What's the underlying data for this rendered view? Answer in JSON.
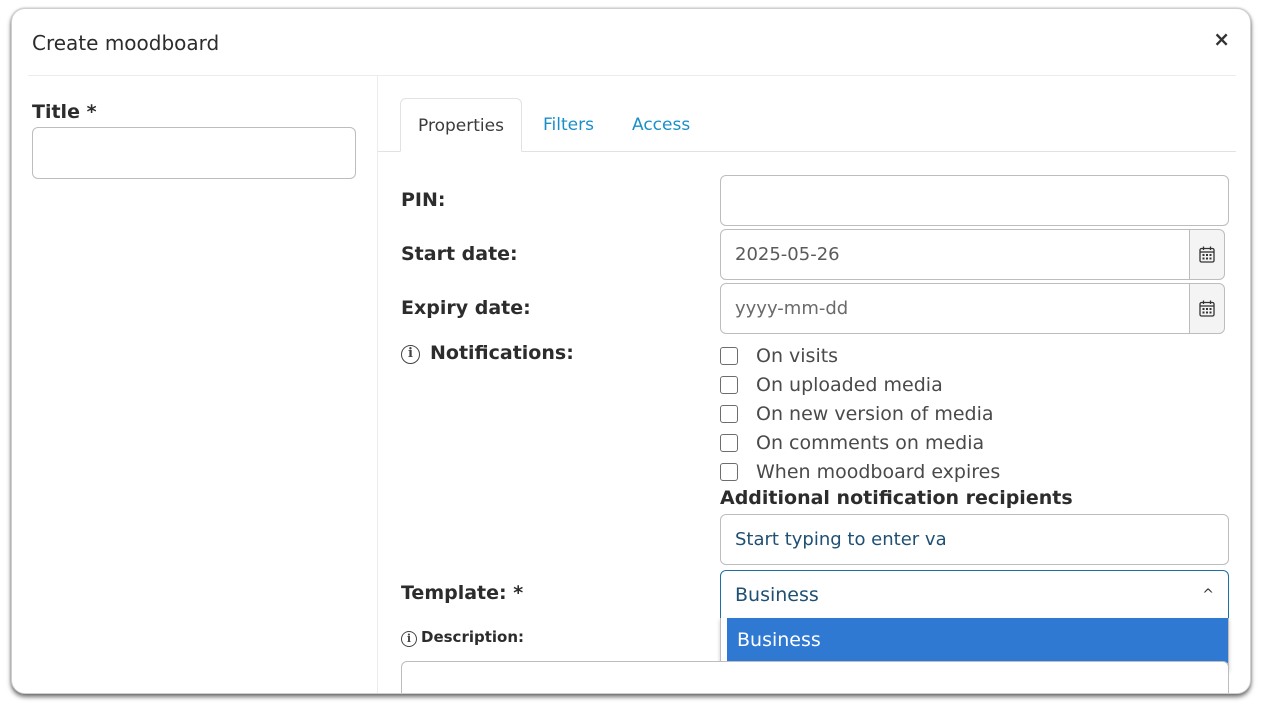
{
  "dialog": {
    "title": "Create moodboard",
    "close_icon": "×"
  },
  "left": {
    "title_label": "Title *",
    "title_value": ""
  },
  "tabs": [
    {
      "label": "Properties",
      "active": true
    },
    {
      "label": "Filters",
      "active": false
    },
    {
      "label": "Access",
      "active": false
    }
  ],
  "form": {
    "pin_label": "PIN:",
    "pin_value": "",
    "start_date_label": "Start date:",
    "start_date_value": "2025-05-26",
    "expiry_date_label": "Expiry date:",
    "expiry_date_placeholder": "yyyy-mm-dd",
    "notifications_label": "Notifications:",
    "notifications": [
      {
        "label": "On visits",
        "checked": false
      },
      {
        "label": "On uploaded media",
        "checked": false
      },
      {
        "label": "On new version of media",
        "checked": false
      },
      {
        "label": "On comments on media",
        "checked": false
      },
      {
        "label": "When moodboard expires",
        "checked": false
      }
    ],
    "recipients_label": "Additional notification recipients",
    "recipients_placeholder": "Start typing to enter va",
    "template_label": "Template: *",
    "template_value": "Business",
    "template_options": [
      "Business"
    ],
    "description_label": "Description:"
  },
  "colors": {
    "accent": "#1a8fc7",
    "selected_option": "#2f79d3",
    "select_border": "#1d6fa5"
  },
  "icons": {
    "close": "close-icon",
    "calendar": "calendar-icon",
    "info": "info-icon",
    "chevron": "chevron-up-icon"
  }
}
